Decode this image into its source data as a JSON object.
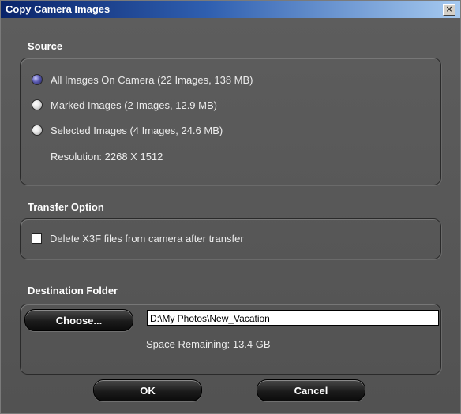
{
  "window": {
    "title": "Copy Camera Images",
    "close_label": "×"
  },
  "source": {
    "heading": "Source",
    "options": [
      {
        "label": "All Images On Camera  (22 Images, 138 MB)",
        "checked": true
      },
      {
        "label": "Marked Images  (2 Images, 12.9 MB)",
        "checked": false
      },
      {
        "label": "Selected Images  (4 Images, 24.6 MB)",
        "checked": false
      }
    ],
    "resolution": "Resolution:   2268 X 1512"
  },
  "transfer": {
    "heading": "Transfer Option",
    "delete_label": "Delete X3F files from camera after transfer",
    "delete_checked": false
  },
  "destination": {
    "heading": "Destination Folder",
    "choose_label": "Choose...",
    "path": "D:\\My Photos\\New_Vacation",
    "space": "Space Remaining:  13.4 GB"
  },
  "buttons": {
    "ok": "OK",
    "cancel": "Cancel"
  },
  "colors": {
    "title_start": "#0a246a",
    "title_end": "#a6caf0",
    "panel": "#575757",
    "radio_selected": "#5a5ab0"
  }
}
